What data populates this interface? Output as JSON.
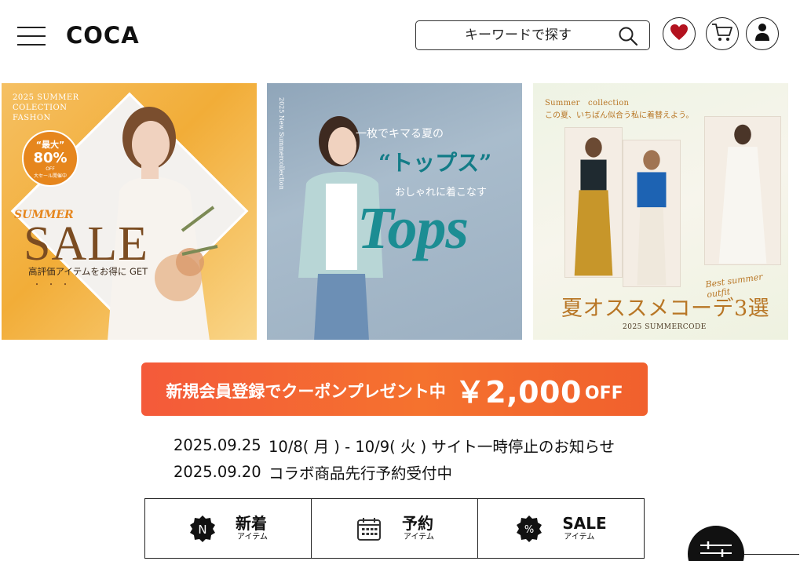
{
  "header": {
    "logo": "COCA",
    "search": {
      "placeholder": "キーワードで探す"
    },
    "icons": [
      "hamburger-menu-icon",
      "search-icon",
      "heart-icon",
      "cart-icon",
      "user-icon"
    ],
    "accent_heart": "#b3121f"
  },
  "banners": [
    {
      "tag_lines": [
        "2025 SUMMER",
        "COLECTION",
        "FASHON"
      ],
      "badge": {
        "top": "“最大”",
        "percent": "80%",
        "off": "OFF",
        "note": "大セール開催中"
      },
      "summer": "SUMMER",
      "sale": "SALE",
      "subtitle": "高評価アイテムをお得に GET",
      "dots": "・・・"
    },
    {
      "side_text": "2025 New Summercollection",
      "line1": "一枚でキマる夏の",
      "line2": "“トップス”",
      "line3": "おしゃれに着こなす",
      "big": "Tops"
    },
    {
      "line1": "Summer　collection",
      "line2": "この夏、いちばん似合う私に着替えよう。",
      "cursive": "Best summer outfit",
      "title": "夏オススメコーデ3選",
      "code": "2025 SUMMERCODE"
    }
  ],
  "coupon": {
    "lead": "新規会員登録でクーポンプレゼント中",
    "amount": "￥2,000",
    "off": "OFF",
    "color": "#f4622f"
  },
  "news": [
    {
      "date": "2025.09.25",
      "text": "10/8( 月 ) - 10/9( 火 ) サイト一時停止のお知らせ"
    },
    {
      "date": "2025.09.20",
      "text": "コラボ商品先行予約受付中"
    }
  ],
  "categories": [
    {
      "icon": "n-badge-icon",
      "icon_text": "N",
      "title": "新着",
      "sub": "アイテム"
    },
    {
      "icon": "calendar-icon",
      "title": "予約",
      "sub": "アイテム"
    },
    {
      "icon": "percent-badge-icon",
      "icon_text": "%",
      "title": "SALE",
      "sub": "アイテム"
    }
  ],
  "fab": {
    "icon": "filter-sliders-icon"
  }
}
